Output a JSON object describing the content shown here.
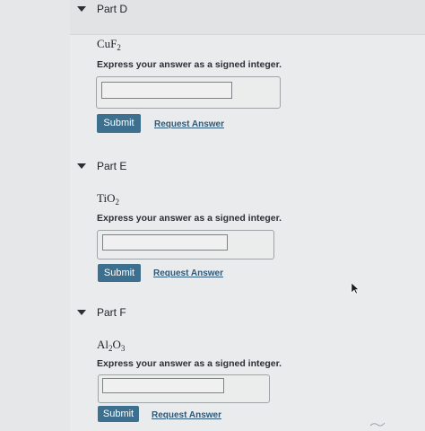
{
  "parts": [
    {
      "title": "Part D",
      "formula_main": "CuF",
      "formula_sub": "2",
      "formula_tail": "",
      "instruction": "Express your answer as a signed integer.",
      "answer_value": "",
      "submit_label": "Submit",
      "request_label": "Request Answer"
    },
    {
      "title": "Part E",
      "formula_main": "TiO",
      "formula_sub": "2",
      "formula_tail": "",
      "instruction": "Express your answer as a signed integer.",
      "answer_value": "",
      "submit_label": "Submit",
      "request_label": "Request Answer"
    },
    {
      "title": "Part F",
      "formula_main": "Al",
      "formula_sub": "2",
      "formula_tail": "O",
      "formula_sub2": "3",
      "instruction": "Express your answer as a signed integer.",
      "answer_value": "",
      "submit_label": "Submit",
      "request_label": "Request Answer"
    }
  ],
  "icons": {
    "collapse": "chevron-down-icon",
    "pointer": "mouse-pointer-icon"
  },
  "colors": {
    "submit_bg": "#3d6f8e",
    "link": "#2f5876",
    "page_bg": "#eaebec"
  }
}
